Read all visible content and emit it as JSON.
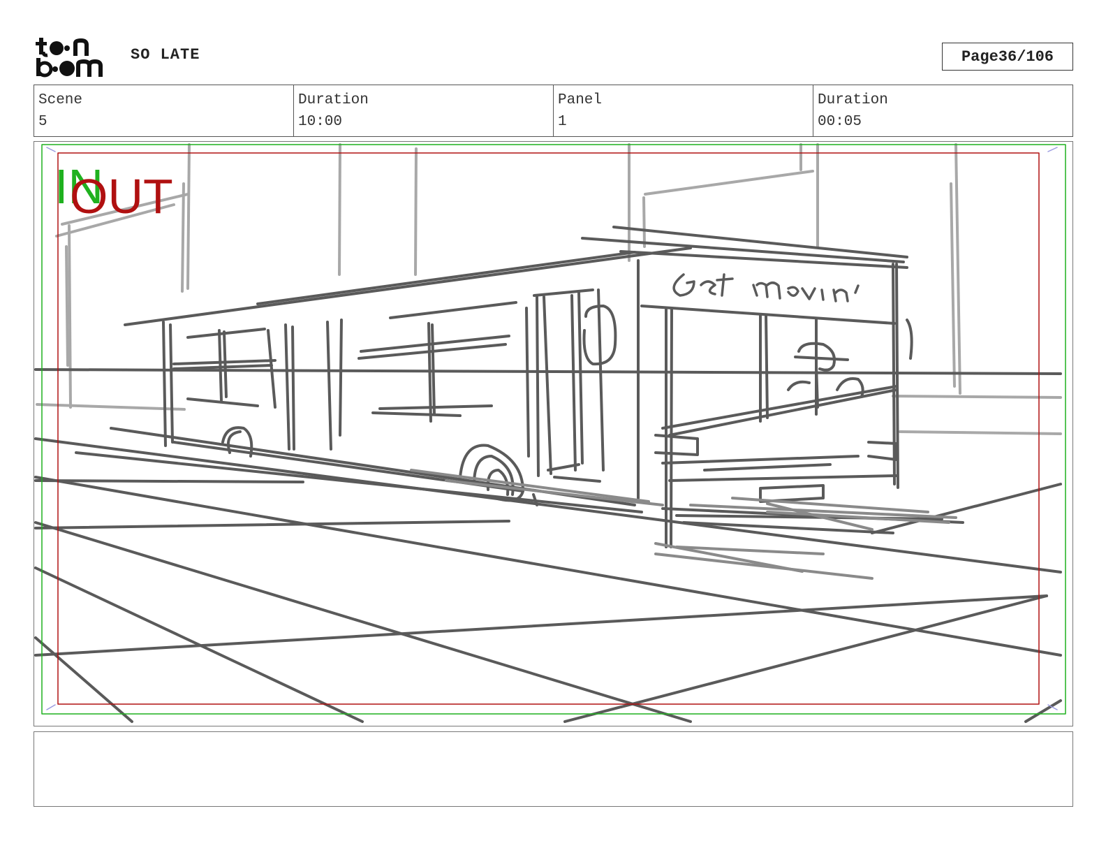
{
  "header": {
    "logo_icon": "toonboom-logo",
    "project_title": "SO LATE",
    "page_label": "Page",
    "page_number": "36/106"
  },
  "info": {
    "scene_label": "Scene",
    "scene_value": "5",
    "scene_duration_label": "Duration",
    "scene_duration_value": "10:00",
    "panel_label": "Panel",
    "panel_value": "1",
    "panel_duration_label": "Duration",
    "panel_duration_value": "00:05"
  },
  "panel": {
    "in_label": "IN",
    "out_label": "OUT",
    "bus_sign_text": "Get movin'",
    "colors": {
      "in_frame": "#1fb11f",
      "out_frame": "#b01010",
      "sketch_dark": "#5a5a5a",
      "sketch_light": "#a8a8a8"
    }
  },
  "caption": {
    "text": ""
  }
}
